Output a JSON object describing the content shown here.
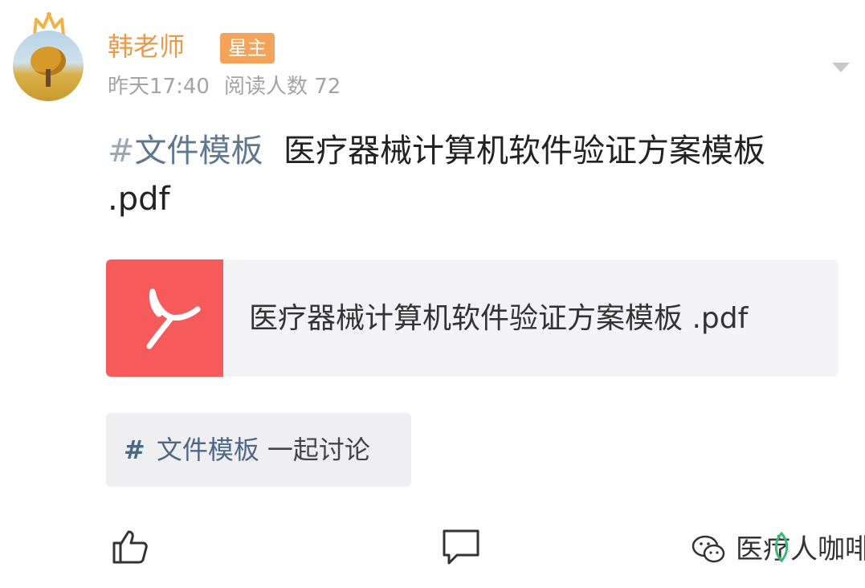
{
  "post": {
    "author": "韩老师",
    "badge": "星主",
    "time": "昨天17:40",
    "read_label": "阅读人数 72",
    "hashtag_symbol": "#",
    "hashtag": "文件模板",
    "text": "医疗器械计算机软件验证方案模板 .pdf"
  },
  "attachment": {
    "file_name": "医疗器械计算机软件验证方案模板 .pdf",
    "icon": "pdf-icon",
    "icon_color": "#f65a5a"
  },
  "topic": {
    "symbol": "#",
    "tag": "文件模板",
    "suffix": "一起讨论"
  },
  "actions": {
    "like_icon": "thumbs-up-icon",
    "comment_icon": "comment-icon"
  },
  "watermark": {
    "brand": "医疗人咖啡"
  },
  "colors": {
    "author": "#e89b4a",
    "badge_bg": "#f3a35a",
    "hashtag": "#5f7892",
    "card_bg": "#f4f4f6"
  }
}
